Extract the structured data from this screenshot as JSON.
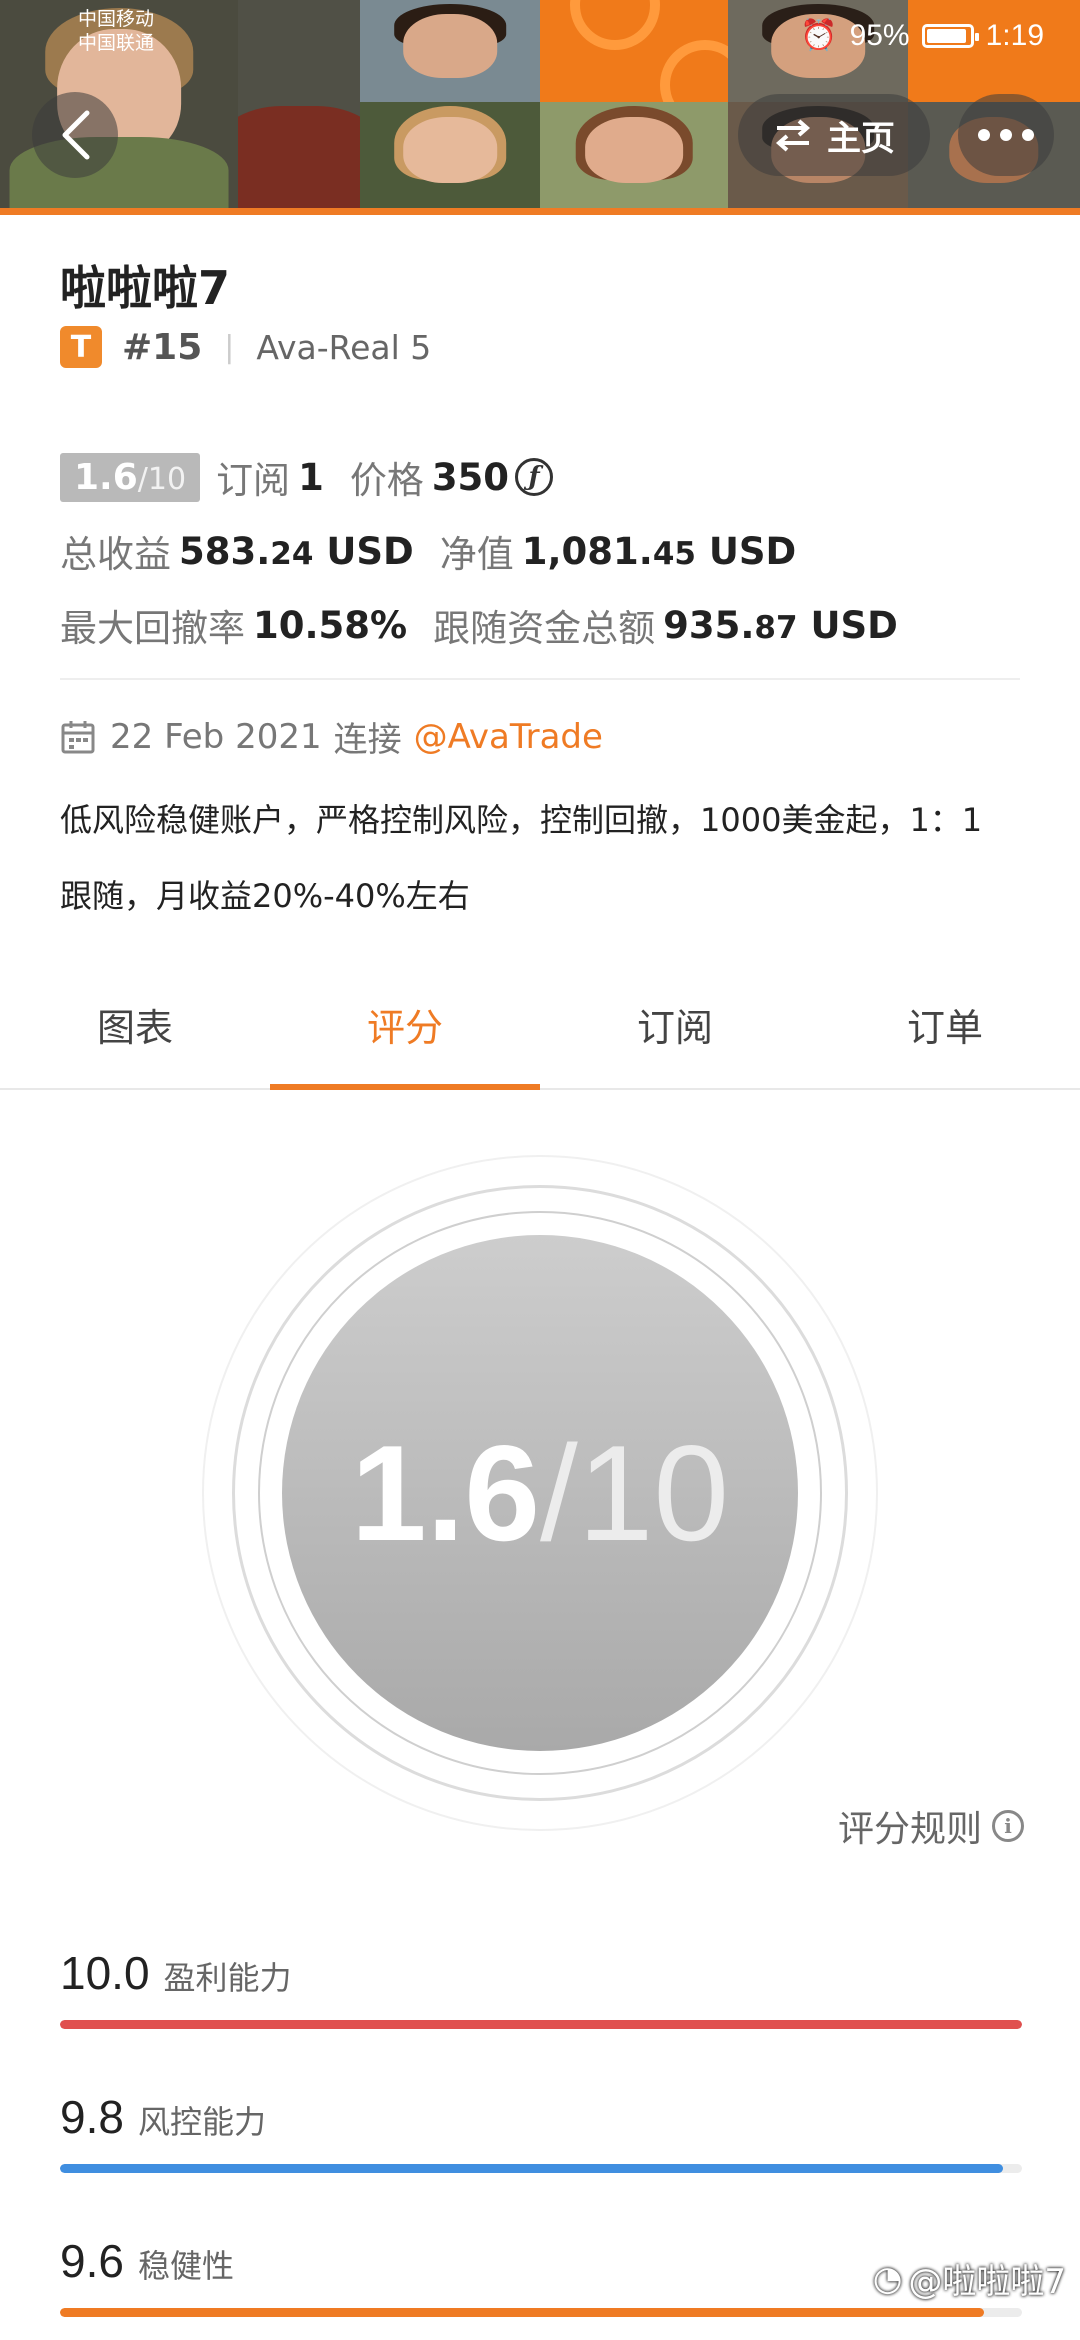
{
  "status_bar": {
    "carrier1": "中国移动",
    "carrier2": "中国联通",
    "battery": "95%",
    "time": "1:19"
  },
  "header": {
    "home_label": "主页"
  },
  "profile": {
    "name": "啦啦啦7",
    "badge": "T",
    "rank": "#15",
    "server": "Ava-Real 5"
  },
  "stats": {
    "score": "1.6",
    "score_max": "/10",
    "subscribe_label": "订阅",
    "subscribe_value": "1",
    "price_label": "价格",
    "price_value": "350",
    "price_unit_icon": "ƒ",
    "total_profit_label": "总收益",
    "total_profit_int": "583.",
    "total_profit_dec": "24",
    "total_profit_unit": "USD",
    "net_value_label": "净值",
    "net_value_int": "1,081.",
    "net_value_dec": "45",
    "net_value_unit": "USD",
    "max_drawdown_label": "最大回撤率",
    "max_drawdown_value": "10.58%",
    "follow_total_label": "跟随资金总额",
    "follow_total_int": "935.",
    "follow_total_dec": "87",
    "follow_total_unit": "USD"
  },
  "connection": {
    "date": "22 Feb 2021",
    "connect_label": "连接",
    "broker": "@AvaTrade"
  },
  "description": "低风险稳健账户，严格控制风险，控制回撤，1000美金起，1：1 跟随，月收益20%-40%左右",
  "tabs": [
    {
      "label": "图表"
    },
    {
      "label": "评分"
    },
    {
      "label": "订阅"
    },
    {
      "label": "订单"
    }
  ],
  "active_tab": "评分",
  "score_circle": {
    "score": "1.6",
    "max": "/10"
  },
  "rules_label": "评分规则",
  "metrics": [
    {
      "value": "10.0",
      "name": "盈利能力",
      "fill": 1.0,
      "color": "#e0504f"
    },
    {
      "value": "9.8",
      "name": "风控能力",
      "fill": 0.98,
      "color": "#3f8ee0"
    },
    {
      "value": "9.6",
      "name": "稳健性",
      "fill": 0.96,
      "color": "#ef7b24"
    }
  ],
  "watermark": "@啦啦啦7",
  "colors": {
    "accent": "#ef7b24",
    "banner_orange": "#f07a1a"
  }
}
